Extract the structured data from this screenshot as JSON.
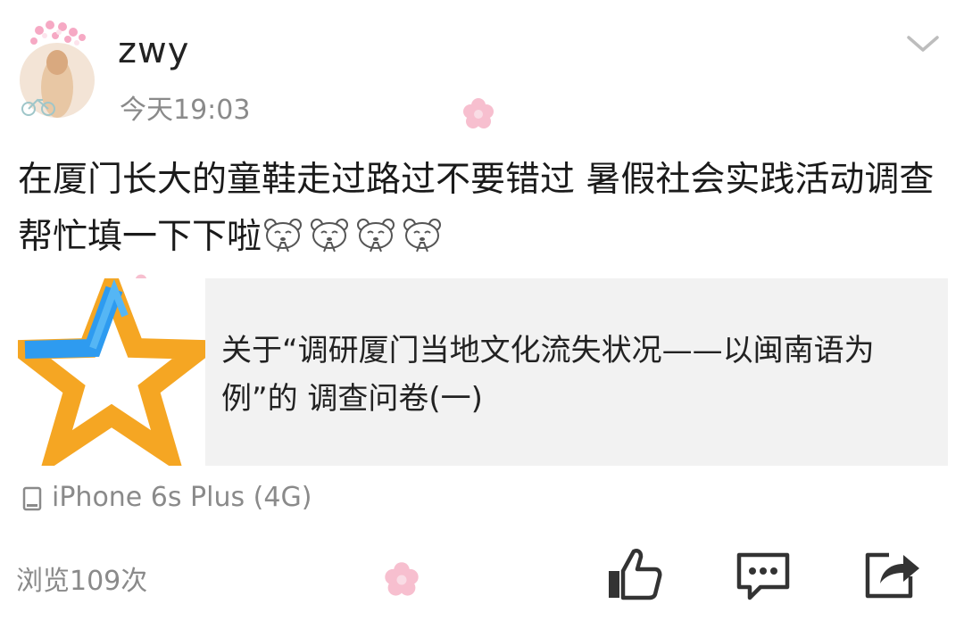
{
  "post": {
    "username": "zwy",
    "timestamp": "今天19:03",
    "text": "在厦门长大的童鞋走过路过不要错过  暑假社会实践活动调查 帮忙填一下下啦",
    "emoji_icons": [
      "bear-praying-emoji",
      "bear-praying-emoji",
      "bear-praying-emoji",
      "bear-praying-emoji"
    ],
    "link_card": {
      "title": "关于“调研厦门当地文化流失状况——以闽南语为例”的 调查问卷(一)",
      "thumbnail_icon": "star-logo"
    },
    "device": "iPhone 6s Plus (4G)",
    "views": "浏览109次"
  },
  "actions": {
    "like_icon": "thumbs-up-icon",
    "comment_icon": "comment-icon",
    "share_icon": "share-icon"
  },
  "colors": {
    "secondary_text": "#8a8a8a",
    "card_background": "#f2f2f2",
    "star_orange": "#f5a623",
    "star_blue": "#2e9bf0"
  }
}
